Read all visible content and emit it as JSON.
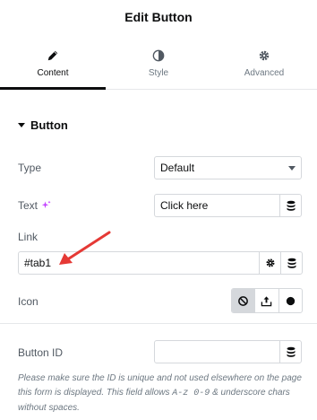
{
  "header": {
    "title": "Edit Button"
  },
  "tabs": [
    {
      "label": "Content",
      "icon": "pencil-icon",
      "active": true
    },
    {
      "label": "Style",
      "icon": "contrast-icon",
      "active": false
    },
    {
      "label": "Advanced",
      "icon": "gear-icon",
      "active": false
    }
  ],
  "section": {
    "title": "Button"
  },
  "fields": {
    "type": {
      "label": "Type",
      "value": "Default"
    },
    "text": {
      "label": "Text",
      "value": "Click here"
    },
    "link": {
      "label": "Link",
      "value": "#tab1"
    },
    "icon": {
      "label": "Icon",
      "options": [
        "none-icon",
        "upload-icon",
        "circle-icon"
      ],
      "selected": "none-icon"
    },
    "button_id": {
      "label": "Button ID",
      "value": ""
    }
  },
  "note": {
    "part1": "Please make sure the ID is unique and not used elsewhere on the page this form is displayed. This field allows ",
    "code": "A-z 0-9",
    "part2": " & underscore chars without spaces."
  },
  "colors": {
    "annotation_arrow": "#e53935",
    "accent_ai": "#c344ff"
  }
}
